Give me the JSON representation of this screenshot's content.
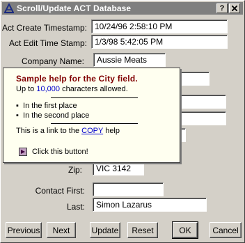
{
  "window": {
    "title": "Scroll/Update ACT Database",
    "help_button": "?",
    "close_button": "X"
  },
  "fields": {
    "create_timestamp": {
      "label": "Act Create Timestamp:",
      "value": "10/24/96 2:58:10 PM"
    },
    "edit_timestamp": {
      "label": "Act Edit Time Stamp:",
      "value": "1/3/98 5:42:05 PM"
    },
    "company_name": {
      "label": "Company Name:",
      "value": "Aussie Meats"
    },
    "zip": {
      "label": "Zip:",
      "value": "VIC 3142"
    },
    "contact_first": {
      "label": "Contact First:",
      "value": ""
    },
    "last": {
      "label": "Last:",
      "value": "Simon Lazarus"
    }
  },
  "help_popup": {
    "title": "Sample help for the City field.",
    "line1_prefix": "Up to ",
    "line1_number": "10,000",
    "line1_suffix": " characters allowed.",
    "bullets": [
      "In the first place",
      "In the second place"
    ],
    "link_prefix": "This is a link to the ",
    "link_text": "COPY",
    "link_suffix": " help",
    "button_text": "Click this button!"
  },
  "buttons": {
    "previous": "Previous",
    "next": "Next",
    "update": "Update",
    "reset": "Reset",
    "ok": "OK",
    "cancel": "Cancel"
  }
}
